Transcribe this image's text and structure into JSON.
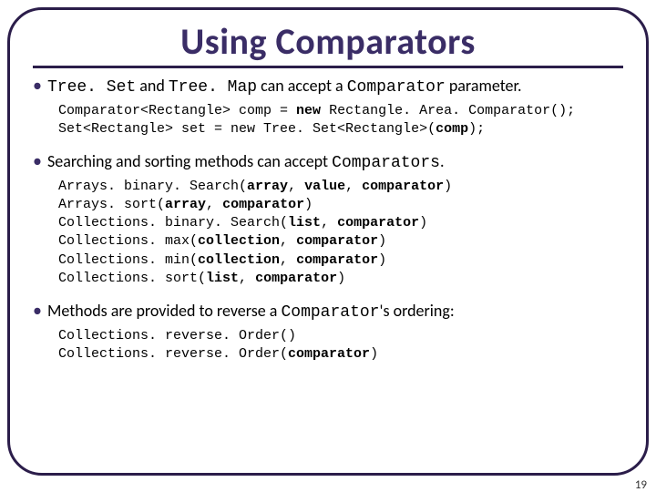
{
  "title": "Using Comparators",
  "bullets": {
    "b1": {
      "pre": "Tree. Set",
      "mid": " and ",
      "pre2": "Tree. Map",
      "mid2": " can accept a ",
      "pre3": "Comparator",
      "tail": " parameter."
    },
    "b2": {
      "pre": "Searching and sorting methods can accept ",
      "mono": "Comparators",
      "tail": "."
    },
    "b3": {
      "pre": "Methods are provided to reverse a ",
      "mono": "Comparator",
      "tail": "'s ordering:"
    }
  },
  "code1": {
    "l1a": "Comparator<Rectangle> comp = ",
    "l1b": "new",
    "l1c": " Rectangle. Area. Comparator();",
    "l2a": "Set<Rectangle> set = new Tree. Set<Rectangle>(",
    "l2b": "comp",
    "l2c": ");"
  },
  "code2": {
    "l1a": "Arrays. binary. Search(",
    "l1b": "array",
    "l1c": ", ",
    "l1d": "value",
    "l1e": ", ",
    "l1f": "comparator",
    "l1g": ")",
    "l2a": "Arrays. sort(",
    "l2b": "array",
    "l2c": ", ",
    "l2d": "comparator",
    "l2e": ")",
    "l3a": "Collections. binary. Search(",
    "l3b": "list",
    "l3c": ", ",
    "l3d": "comparator",
    "l3e": ")",
    "l4a": "Collections. max(",
    "l4b": "collection",
    "l4c": ", ",
    "l4d": "comparator",
    "l4e": ")",
    "l5a": "Collections. min(",
    "l5b": "collection",
    "l5c": ", ",
    "l5d": "comparator",
    "l5e": ")",
    "l6a": "Collections. sort(",
    "l6b": "list",
    "l6c": ", ",
    "l6d": "comparator",
    "l6e": ")"
  },
  "code3": {
    "l1": "Collections. reverse. Order()",
    "l2a": "Collections. reverse. Order(",
    "l2b": "comparator",
    "l2c": ")"
  },
  "page": "19"
}
